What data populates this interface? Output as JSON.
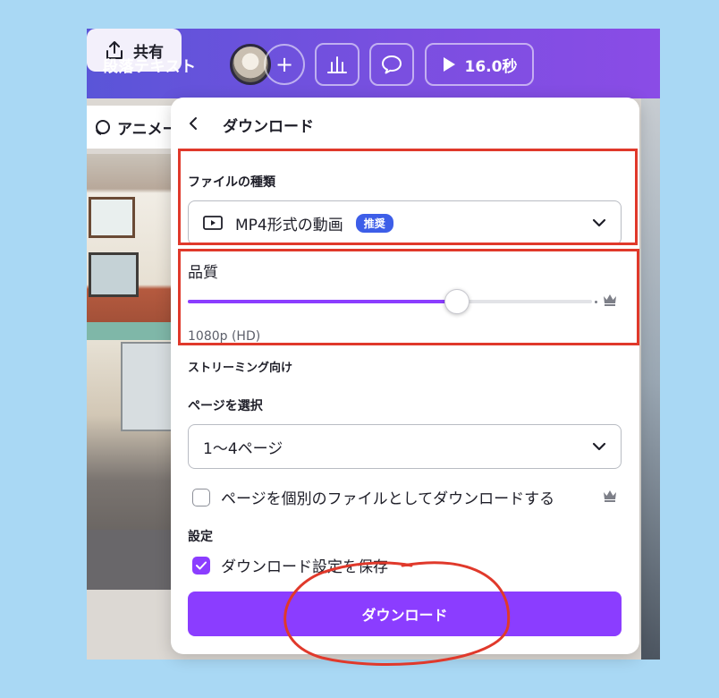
{
  "toolbar": {
    "doc_title": "段落テキスト",
    "add_label": "+",
    "play_duration": "16.0秒",
    "share_label": "共有"
  },
  "canvas": {
    "animate_label": "アニメー"
  },
  "panel": {
    "title": "ダウンロード",
    "file_type_label": "ファイルの種類",
    "file_type_value": "MP4形式の動画",
    "file_type_badge": "推奨",
    "quality_label": "品質",
    "quality_value": "1080p (HD)",
    "quality_desc": "ストリーミング向け",
    "quality_fraction": 0.665,
    "pages_label": "ページを選択",
    "pages_value": "1〜4ページ",
    "separate_files_label": "ページを個別のファイルとしてダウンロードする",
    "separate_files_checked": false,
    "settings_label": "設定",
    "save_settings_label": "ダウンロード設定を保存",
    "save_settings_checked": true,
    "download_button": "ダウンロード"
  },
  "colors": {
    "accent": "#8b3dff",
    "badge": "#3d5ee8",
    "annotation": "#e0392b"
  },
  "icons": [
    "chart-icon",
    "comment-icon",
    "play-icon",
    "share-icon",
    "back-icon",
    "video-icon",
    "chevron-down-icon",
    "crown-icon",
    "check-icon",
    "animate-icon"
  ]
}
